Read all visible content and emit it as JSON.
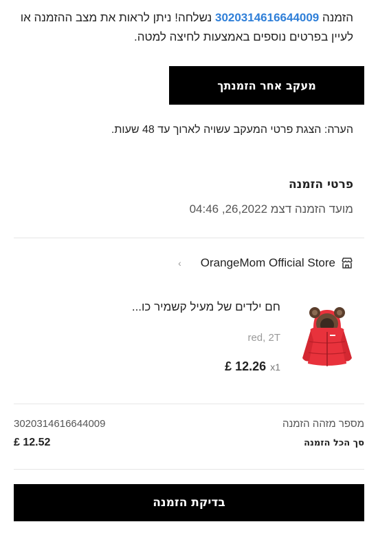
{
  "intro": {
    "prefix": "הזמנה ",
    "order_number": "3020314616644009",
    "suffix": " נשלחה! ניתן לראות את מצב ההזמנה או לעיין בפרטים נוספים באמצעות לחיצה למטה."
  },
  "track_button": "מעקב אחר הזמנתך",
  "note": "הערה: הצגת פרטי המעקב עשויה לארוך עד 48 שעות.",
  "details": {
    "title": "פרטי הזמנה",
    "date": "מועד הזמנה דצמ 26,2022, 04:46"
  },
  "store": {
    "icon": "store-icon",
    "name": "OrangeMom Official Store",
    "chevron": "›"
  },
  "product": {
    "image_desc": "red-puffer-jacket",
    "title": "חם ילדים של מעיל קשמיר כו...",
    "variant": "red, 2T",
    "quantity": "x1",
    "price": "£ 12.26"
  },
  "summary": {
    "order_id_label": "מספר מזהה הזמנה",
    "order_id_value": "3020314616644009",
    "total_label": "סך הכל הזמנה",
    "total_value": "£ 12.52"
  },
  "check_button": "בדיקת הזמנה",
  "colors": {
    "accent_link": "#2f7fd8",
    "button_bg": "#000000",
    "product_red": "#e8323c"
  }
}
